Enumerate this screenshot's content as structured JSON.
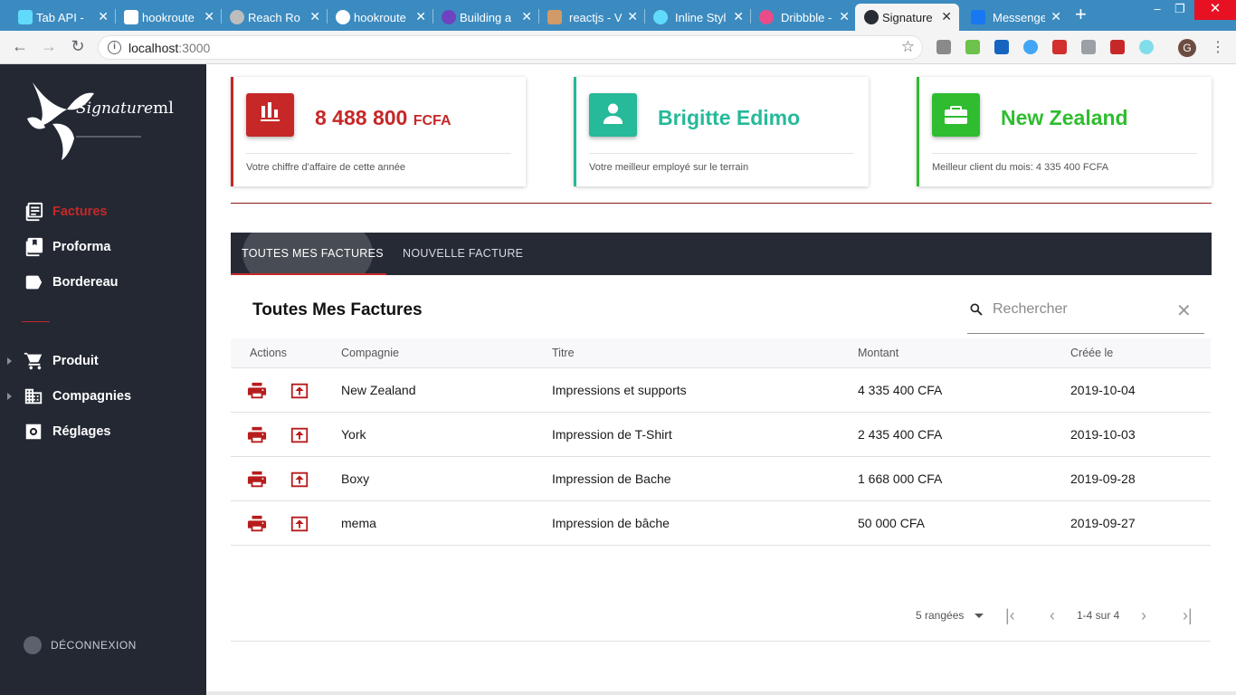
{
  "browser": {
    "tabs": [
      {
        "title": "Tab API -",
        "fav_color": "#61dafb"
      },
      {
        "title": "hookrouter",
        "fav_color": "#ffffff"
      },
      {
        "title": "Reach Router",
        "fav_color": "#bdbdbd"
      },
      {
        "title": "hookrouter",
        "fav_color": "#ffffff"
      },
      {
        "title": "Building a",
        "fav_color": "#6f42c1"
      },
      {
        "title": "reactjs - V",
        "fav_color": "#d19a66"
      },
      {
        "title": "Inline Styl",
        "fav_color": "#61dafb"
      },
      {
        "title": "Dribbble -",
        "fav_color": "#ea4c89"
      },
      {
        "title": "Signature",
        "fav_color": "#61dafb"
      },
      {
        "title": "Messenger",
        "fav_color": "#1877f2"
      }
    ],
    "active_tab": "Signature",
    "url_host": "localhost",
    "url_port": ":3000",
    "profile_initial": "G"
  },
  "sidebar": {
    "logo_text": "Signature",
    "logo_suffix": "ml",
    "items": [
      {
        "label": "Factures",
        "icon": "list-icon"
      },
      {
        "label": "Proforma",
        "icon": "library-icon"
      },
      {
        "label": "Bordereau",
        "icon": "label-icon"
      },
      {
        "label": "Produit",
        "icon": "cart-icon"
      },
      {
        "label": "Compagnies",
        "icon": "building-icon"
      },
      {
        "label": "Réglages",
        "icon": "settings-icon"
      }
    ],
    "logout_label": "DÉCONNEXION"
  },
  "cards": [
    {
      "value": "8 488 800",
      "unit": "FCFA",
      "description": "Votre chiffre d'affaire de cette année",
      "color": "#c62828",
      "icon": "bar-chart-icon"
    },
    {
      "value": "Brigitte Edimo",
      "unit": "",
      "description": "Votre meilleur employé sur le terrain",
      "color": "#26b99a",
      "icon": "person-icon"
    },
    {
      "value": "New Zealand",
      "unit": "",
      "description": "Meilleur client du mois: 4 335 400 FCFA",
      "color": "#2fbd2f",
      "icon": "briefcase-icon"
    }
  ],
  "tabs": {
    "all": "TOUTES MES FACTURES",
    "new": "NOUVELLE FACTURE"
  },
  "table": {
    "title": "Toutes Mes Factures",
    "search_placeholder": "Rechercher",
    "columns": [
      "Actions",
      "Compagnie",
      "Titre",
      "Montant",
      "Créée le"
    ],
    "rows": [
      {
        "company": "New Zealand",
        "title": "Impressions et supports",
        "amount": "4 335 400 CFA",
        "date": "2019-10-04"
      },
      {
        "company": "York",
        "title": "Impression de T-Shirt",
        "amount": "2 435 400 CFA",
        "date": "2019-10-03"
      },
      {
        "company": "Boxy",
        "title": "Impression de Bache",
        "amount": "1 668 000 CFA",
        "date": "2019-09-28"
      },
      {
        "company": "mema",
        "title": "Impression de bâche",
        "amount": "50 000 CFA",
        "date": "2019-09-27"
      }
    ]
  },
  "pagination": {
    "rows_label": "5 rangées",
    "range_label": "1-4 sur 4"
  },
  "colors": {
    "accent_red": "#c62828",
    "sidebar_bg": "#232833",
    "tabs_bg": "#252a34",
    "action_red": "#b71c1c"
  }
}
